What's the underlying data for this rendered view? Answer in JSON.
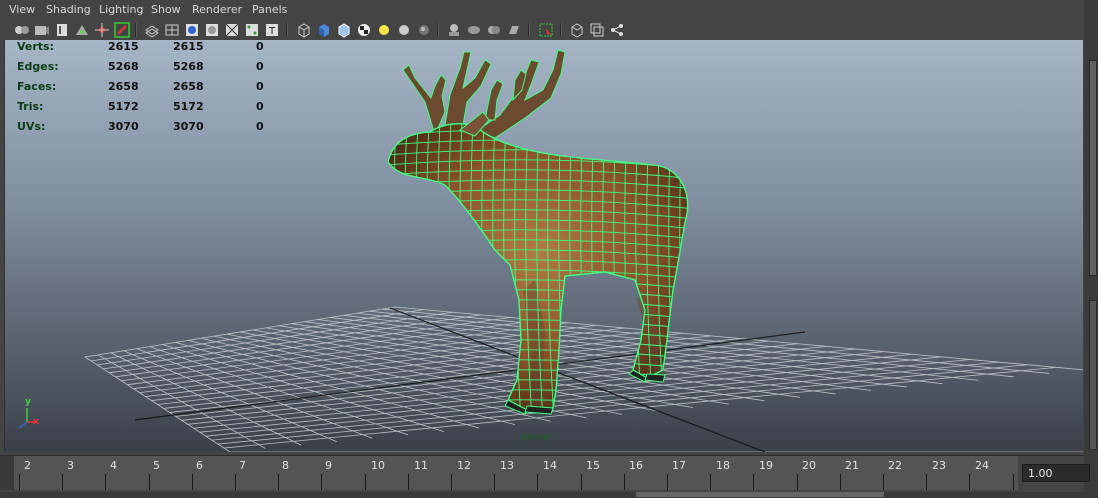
{
  "menu": {
    "items": [
      "View",
      "Shading",
      "Lighting",
      "Show",
      "Renderer",
      "Panels"
    ]
  },
  "toolbar": {
    "icons": [
      "select-camera-icon",
      "camera-attributes-icon",
      "bookmark-icon",
      "image-plane-icon",
      "2d-pan-zoom-icon",
      "grease-pencil-icon",
      "wireframe-icon",
      "smooth-shade-icon",
      "grid-icon",
      "film-gate-icon",
      "resolution-gate-icon",
      "gate-mask-icon",
      "field-chart-icon",
      "safe-action-icon",
      "title-safe-icon",
      "wireframe-shade-icon",
      "smooth-shade-all-icon",
      "default-material-icon",
      "textured-icon",
      "lights-icon",
      "shadows-icon",
      "ambient-occlusion-icon",
      "isolate-select-icon",
      "xray-icon",
      "xray-joints-icon",
      "xray-components-icon",
      "select-highlight-icon",
      "single-view-icon",
      "two-views-icon",
      "layout-share-icon"
    ]
  },
  "hud": {
    "rows": [
      {
        "label": "Verts:",
        "values": [
          "2615",
          "2615",
          "0"
        ]
      },
      {
        "label": "Edges:",
        "values": [
          "5268",
          "5268",
          "0"
        ]
      },
      {
        "label": "Faces:",
        "values": [
          "2658",
          "2658",
          "0"
        ]
      },
      {
        "label": "Tris:",
        "values": [
          "5172",
          "5172",
          "0"
        ]
      },
      {
        "label": "UVs:",
        "values": [
          "3070",
          "3070",
          "0"
        ]
      }
    ],
    "camera_label": "persp",
    "axis": {
      "y": "y",
      "x": "x"
    }
  },
  "timeline": {
    "frames": [
      "2",
      "3",
      "4",
      "5",
      "6",
      "7",
      "8",
      "9",
      "10",
      "11",
      "12",
      "13",
      "14",
      "15",
      "16",
      "17",
      "18",
      "19",
      "20",
      "21",
      "22",
      "23",
      "24"
    ],
    "current_value": "1.00"
  },
  "colors": {
    "wireframe": "#3dff84",
    "fur": "#8a5328",
    "grid": "#cfd3d6",
    "viewport_top": "#a6b6c7",
    "viewport_bottom": "#3a4048",
    "hud_label": "#0a3d12"
  }
}
